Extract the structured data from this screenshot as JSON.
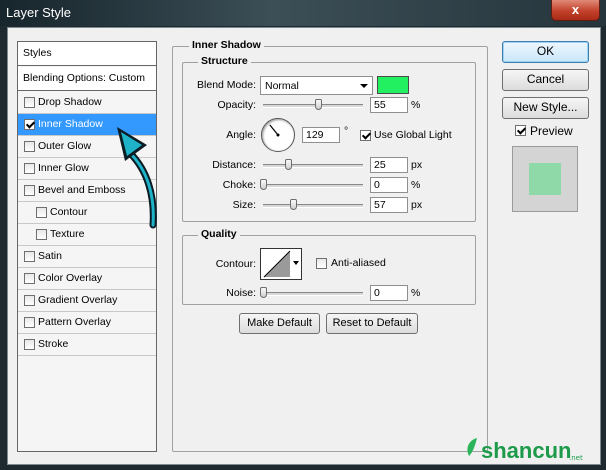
{
  "window": {
    "title": "Layer Style",
    "close_glyph": "x"
  },
  "styles_list": {
    "header": "Styles",
    "blending": "Blending Options: Custom",
    "items": [
      {
        "label": "Drop Shadow",
        "checked": false,
        "selected": false,
        "indent": false
      },
      {
        "label": "Inner Shadow",
        "checked": true,
        "selected": true,
        "indent": false
      },
      {
        "label": "Outer Glow",
        "checked": false,
        "selected": false,
        "indent": false
      },
      {
        "label": "Inner Glow",
        "checked": false,
        "selected": false,
        "indent": false
      },
      {
        "label": "Bevel and Emboss",
        "checked": false,
        "selected": false,
        "indent": false
      },
      {
        "label": "Contour",
        "checked": false,
        "selected": false,
        "indent": true
      },
      {
        "label": "Texture",
        "checked": false,
        "selected": false,
        "indent": true
      },
      {
        "label": "Satin",
        "checked": false,
        "selected": false,
        "indent": false
      },
      {
        "label": "Color Overlay",
        "checked": false,
        "selected": false,
        "indent": false
      },
      {
        "label": "Gradient Overlay",
        "checked": false,
        "selected": false,
        "indent": false
      },
      {
        "label": "Pattern Overlay",
        "checked": false,
        "selected": false,
        "indent": false
      },
      {
        "label": "Stroke",
        "checked": false,
        "selected": false,
        "indent": false
      }
    ]
  },
  "inner_shadow": {
    "title": "Inner Shadow",
    "structure": {
      "title": "Structure",
      "blend_mode_label": "Blend Mode:",
      "blend_mode_value": "Normal",
      "color": "#22f060",
      "opacity_label": "Opacity:",
      "opacity_value": "55",
      "opacity_unit": "%",
      "opacity_level": 0.55,
      "angle_label": "Angle:",
      "angle_value": "129",
      "angle_unit": "°",
      "angle_degrees": 129,
      "global_light_label": "Use Global Light",
      "global_light_checked": true,
      "distance_label": "Distance:",
      "distance_value": "25",
      "distance_unit": "px",
      "distance_level": 0.25,
      "choke_label": "Choke:",
      "choke_value": "0",
      "choke_unit": "%",
      "choke_level": 0.0,
      "size_label": "Size:",
      "size_value": "57",
      "size_unit": "px",
      "size_level": 0.3
    },
    "quality": {
      "title": "Quality",
      "contour_label": "Contour:",
      "anti_aliased_label": "Anti-aliased",
      "anti_aliased_checked": false,
      "noise_label": "Noise:",
      "noise_value": "0",
      "noise_unit": "%",
      "noise_level": 0.0
    },
    "make_default_label": "Make Default",
    "reset_default_label": "Reset to Default"
  },
  "buttons": {
    "ok": "OK",
    "cancel": "Cancel",
    "new_style": "New Style..."
  },
  "preview": {
    "label": "Preview",
    "checked": true,
    "swatch_color": "#8fd8a8"
  }
}
